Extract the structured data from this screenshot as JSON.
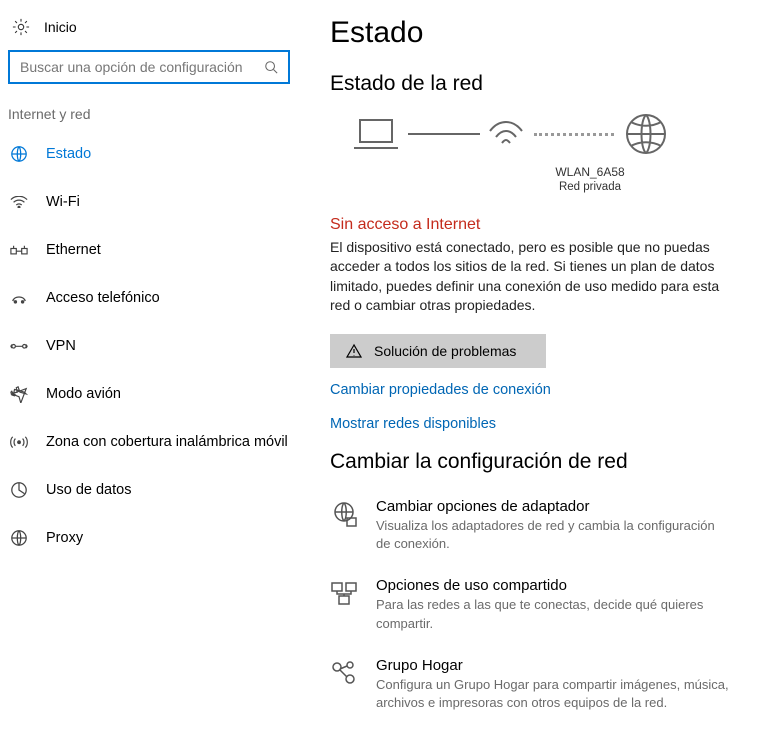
{
  "sidebar": {
    "home": "Inicio",
    "search_placeholder": "Buscar una opción de configuración",
    "section": "Internet y red",
    "items": [
      {
        "label": "Estado",
        "active": true
      },
      {
        "label": "Wi-Fi"
      },
      {
        "label": "Ethernet"
      },
      {
        "label": "Acceso telefónico"
      },
      {
        "label": "VPN"
      },
      {
        "label": "Modo avión"
      },
      {
        "label": "Zona con cobertura inalámbrica móvil"
      },
      {
        "label": "Uso de datos"
      },
      {
        "label": "Proxy"
      }
    ]
  },
  "main": {
    "title": "Estado",
    "section1": "Estado de la red",
    "net_name": "WLAN_6A58",
    "net_type": "Red privada",
    "warning": "Sin acceso a Internet",
    "paragraph": "El dispositivo está conectado, pero es posible que no puedas acceder a todos los sitios de la red. Si tienes un plan de datos limitado, puedes definir una conexión de uso medido para esta red o cambiar otras propiedades.",
    "troubleshoot": "Solución de problemas",
    "link1": "Cambiar propiedades de conexión",
    "link2": "Mostrar redes disponibles",
    "section2": "Cambiar la configuración de red",
    "options": [
      {
        "title": "Cambiar opciones de adaptador",
        "desc": "Visualiza los adaptadores de red y cambia la configuración de conexión."
      },
      {
        "title": "Opciones de uso compartido",
        "desc": "Para las redes a las que te conectas, decide qué quieres compartir."
      },
      {
        "title": "Grupo Hogar",
        "desc": "Configura un Grupo Hogar para compartir imágenes, música, archivos e impresoras con otros equipos de la red."
      }
    ]
  }
}
